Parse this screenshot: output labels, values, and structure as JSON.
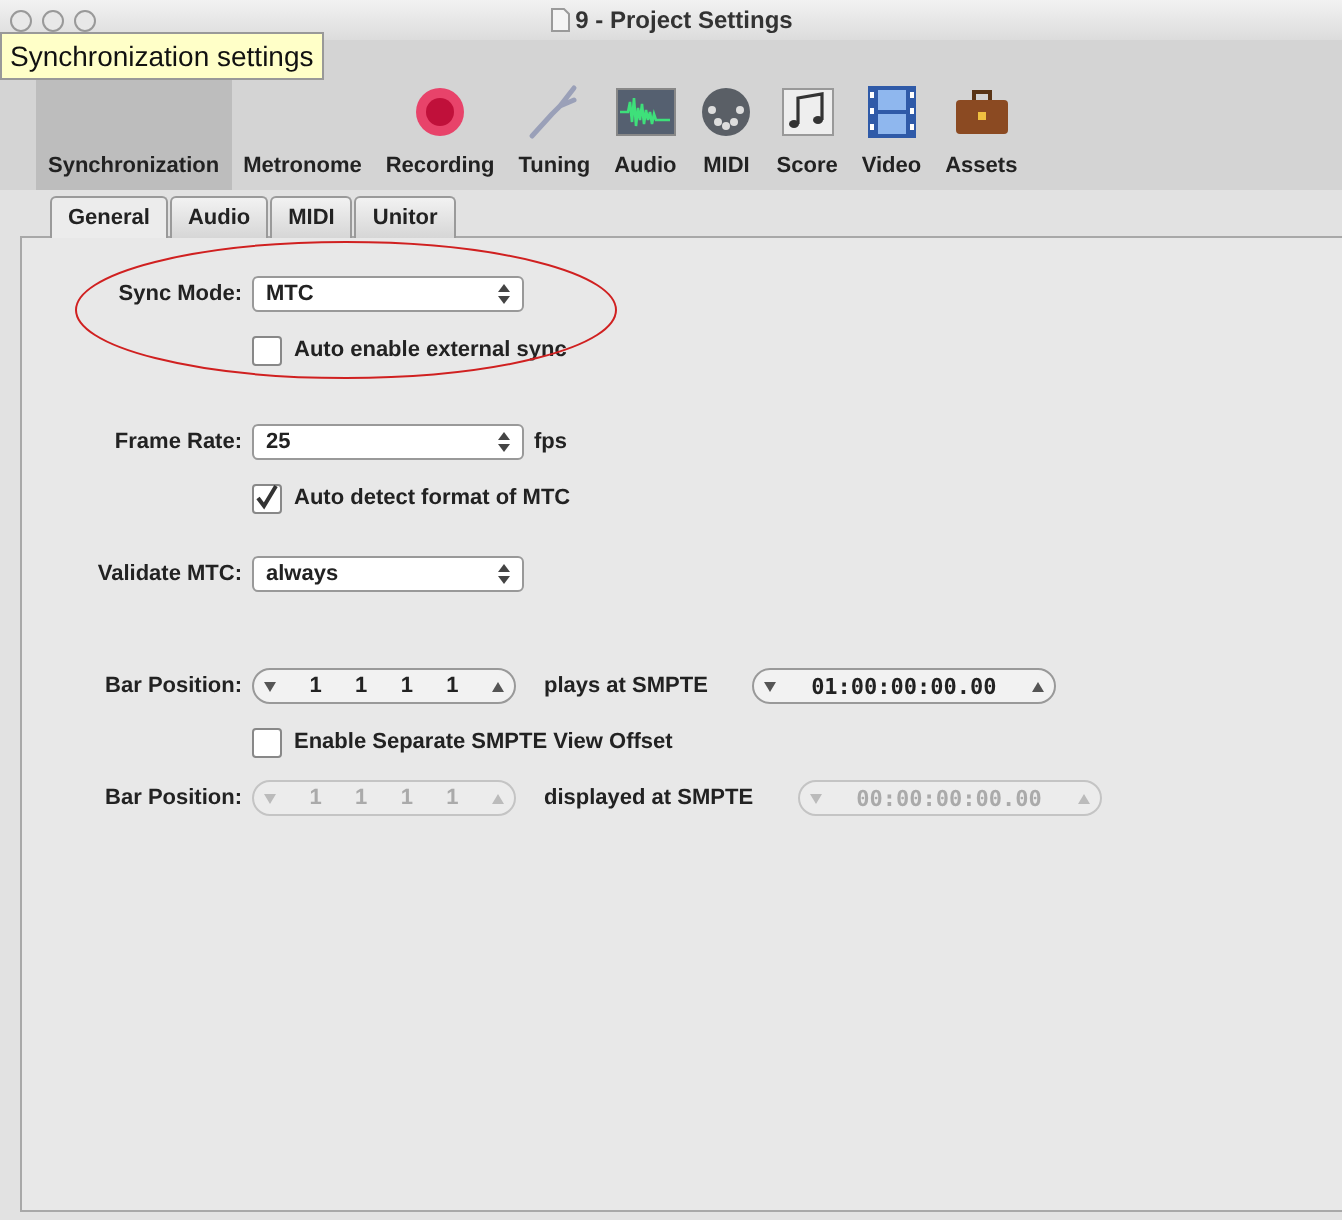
{
  "window": {
    "title": "9 - Project Settings"
  },
  "tooltip": "Synchronization settings",
  "toolbar": [
    {
      "label": "Synchronization",
      "selected": true
    },
    {
      "label": "Metronome",
      "selected": false
    },
    {
      "label": "Recording",
      "selected": false,
      "kind": "record"
    },
    {
      "label": "Tuning",
      "selected": false,
      "kind": "fork"
    },
    {
      "label": "Audio",
      "selected": false,
      "kind": "wave"
    },
    {
      "label": "MIDI",
      "selected": false,
      "kind": "din"
    },
    {
      "label": "Score",
      "selected": false,
      "kind": "notes"
    },
    {
      "label": "Video",
      "selected": false,
      "kind": "film"
    },
    {
      "label": "Assets",
      "selected": false,
      "kind": "case"
    }
  ],
  "tabs": [
    {
      "label": "General",
      "selected": true
    },
    {
      "label": "Audio",
      "selected": false
    },
    {
      "label": "MIDI",
      "selected": false
    },
    {
      "label": "Unitor",
      "selected": false
    }
  ],
  "sections": [
    [
      {
        "kind": "select",
        "label": "Sync Mode:",
        "value": "MTC"
      },
      {
        "kind": "checkbox",
        "label": "Auto enable external sync",
        "checked": false
      }
    ],
    [
      {
        "kind": "select",
        "label": "Frame Rate:",
        "value": "25",
        "unit": "fps"
      },
      {
        "kind": "checkbox",
        "label": "Auto detect format of MTC",
        "checked": true
      }
    ],
    [
      {
        "kind": "select",
        "label": "Validate MTC:",
        "value": "always"
      }
    ],
    [
      {
        "kind": "position",
        "label": "Bar Position:",
        "bar": [
          "1",
          "1",
          "1",
          "1"
        ],
        "caption": "plays at SMPTE",
        "smpte": "01:00:00:00.00",
        "disabled": false
      },
      {
        "kind": "checkbox",
        "label": "Enable Separate SMPTE View Offset",
        "checked": false
      },
      {
        "kind": "position",
        "label": "Bar Position:",
        "bar": [
          "1",
          "1",
          "1",
          "1"
        ],
        "caption": "displayed at SMPTE",
        "smpte": "00:00:00:00.00",
        "disabled": true
      }
    ]
  ]
}
